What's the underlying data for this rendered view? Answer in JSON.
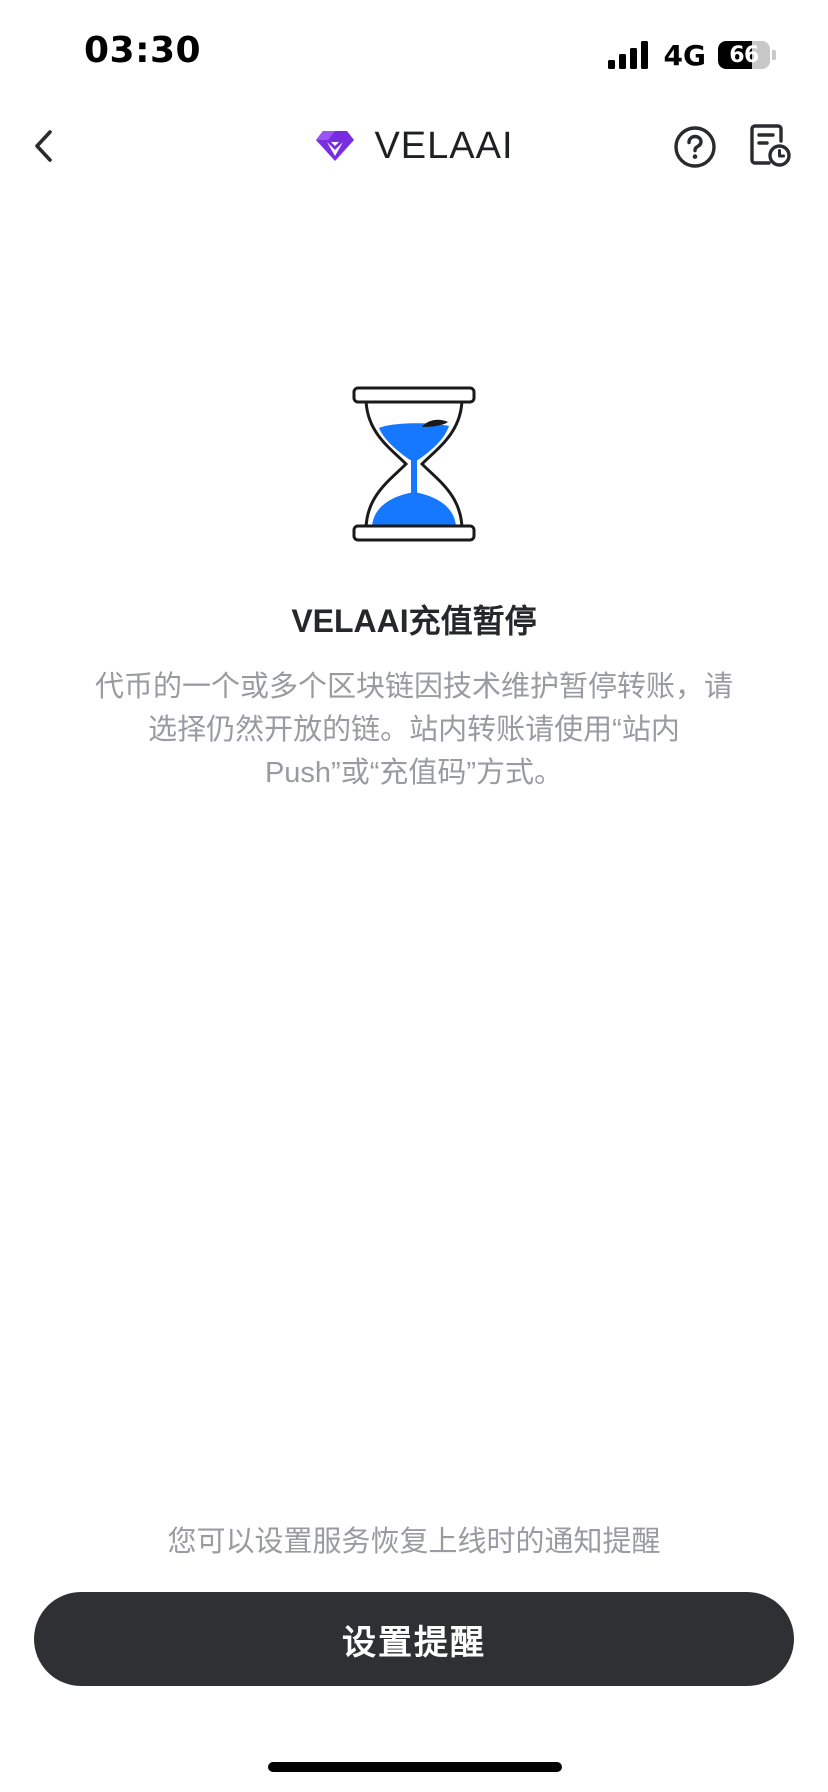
{
  "status_bar": {
    "time": "03:30",
    "network": "4G",
    "battery_level": "66",
    "battery_fraction": 0.66,
    "signal_icon": "signal-bars-icon"
  },
  "nav": {
    "title": "VELAAI",
    "logo_icon": "velaai-logo-icon",
    "back_icon": "chevron-left-icon",
    "help_icon": "help-circle-icon",
    "history_icon": "document-clock-icon"
  },
  "main": {
    "illustration": "hourglass-icon",
    "title": "VELAAI充值暂停",
    "description": "代币的一个或多个区块链因技术维护暂停转账，请选择仍然开放的链。站内转账请使用“站内Push”或“充值码”方式。"
  },
  "footer": {
    "hint": "您可以设置服务恢复上线时的通知提醒",
    "button_label": "设置提醒"
  },
  "colors": {
    "brand_purple": "#7a2de0",
    "hourglass_blue": "#1677ff",
    "button_dark": "#2f3034",
    "muted_text": "#9a9ba1"
  }
}
